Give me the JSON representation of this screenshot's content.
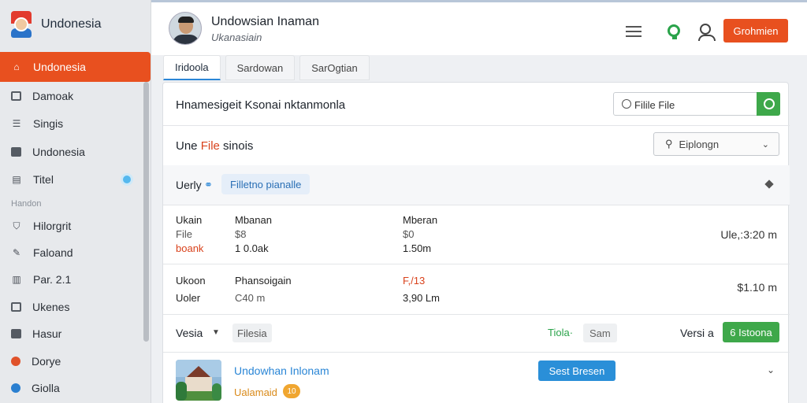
{
  "app": {
    "brand_name": "Undonesia"
  },
  "sidebar": {
    "active_item": "Undonesia",
    "items": [
      {
        "label": "Damoak",
        "icon": "document-icon"
      },
      {
        "label": "Singis",
        "icon": "list-icon"
      },
      {
        "label": "Undonesia",
        "icon": "folder-icon"
      },
      {
        "label": "Titel",
        "icon": "table-icon"
      }
    ],
    "section_label": "Handon",
    "items2": [
      {
        "label": "Hilorgrit",
        "icon": "shield-icon"
      },
      {
        "label": "Faloand",
        "icon": "wrench-icon"
      },
      {
        "label": "Par. 2.1",
        "icon": "chart-icon"
      },
      {
        "label": "Ukenes",
        "icon": "edit-icon"
      },
      {
        "label": "Hasur",
        "icon": "box-icon"
      },
      {
        "label": "Dorye",
        "icon": "flower-icon"
      },
      {
        "label": "Giolla",
        "icon": "globe-icon"
      }
    ]
  },
  "header": {
    "user_name": "Undowsian Inaman",
    "user_sub": "Ukanasiain",
    "action_button": "Grohmien"
  },
  "tabs": [
    "Iridoola",
    "Sardowan",
    "SarOgtian"
  ],
  "panel": {
    "title": "Hnamesigeit Ksonai nktanmonla",
    "search_placeholder": "Filile File"
  },
  "section": {
    "title_prefix": "Une",
    "title_highlight": "File",
    "title_suffix": "sinois",
    "filter_label": "Eiplongn"
  },
  "verify": {
    "label": "Uerly",
    "chip": "Filletno pianalle"
  },
  "rows": [
    {
      "col1": [
        "Ukain",
        "File",
        "boank"
      ],
      "col2": [
        "Mbanan",
        "$8",
        "1 0.0ak"
      ],
      "col3": [
        "Mberan",
        "$0",
        "1.50m"
      ],
      "right": "Ule,:3:20 m"
    },
    {
      "col1": [
        "Ukoon",
        "Uoler"
      ],
      "col2": [
        "Phansoigain",
        "C40 m"
      ],
      "col3": [
        "F,/13",
        "3,90 Lm"
      ],
      "right": "$1.10 m"
    }
  ],
  "version_bar": {
    "label": "Vesia",
    "chip": "Filesia",
    "tilde": "Tiola·",
    "sam": "Sam",
    "right_label": "Versi a",
    "button": "6 Istoona"
  },
  "item": {
    "title": "Undowhan Inlonam",
    "subtitle": "Ualamaid",
    "badge": "10",
    "button": "Sest Bresen"
  },
  "colors": {
    "accent": "#e8501f",
    "green": "#3ea84a",
    "blue": "#2a8fd8"
  }
}
